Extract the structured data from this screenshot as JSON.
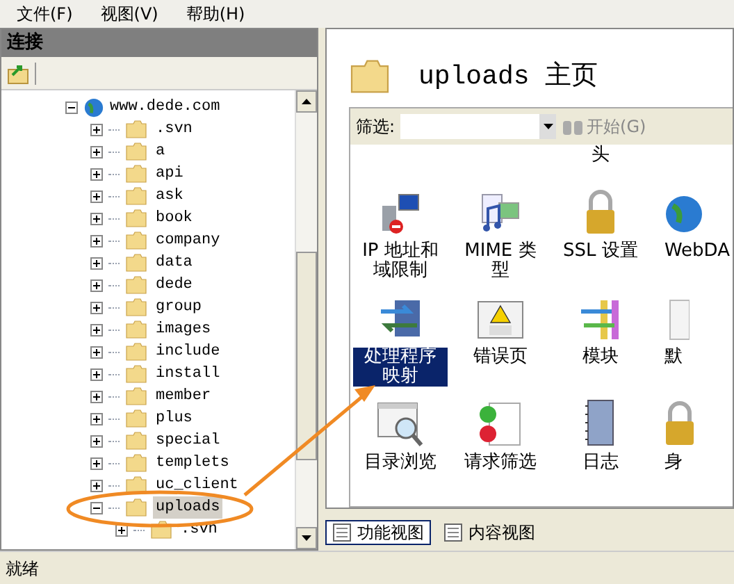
{
  "menu": [
    {
      "label": "文件(F)"
    },
    {
      "label": "视图(V)"
    },
    {
      "label": "帮助(H)"
    }
  ],
  "connections": {
    "title": "连接"
  },
  "tree": {
    "label": "www.dede.com",
    "expanded": true,
    "selected": false,
    "children": [
      {
        "label": ".svn",
        "expanded": false,
        "selected": false
      },
      {
        "label": "a",
        "expanded": false,
        "selected": false
      },
      {
        "label": "api",
        "expanded": false,
        "selected": false
      },
      {
        "label": "ask",
        "expanded": false,
        "selected": false
      },
      {
        "label": "book",
        "expanded": false,
        "selected": false
      },
      {
        "label": "company",
        "expanded": false,
        "selected": false
      },
      {
        "label": "data",
        "expanded": false,
        "selected": false
      },
      {
        "label": "dede",
        "expanded": false,
        "selected": false
      },
      {
        "label": "group",
        "expanded": false,
        "selected": false
      },
      {
        "label": "images",
        "expanded": false,
        "selected": false
      },
      {
        "label": "include",
        "expanded": false,
        "selected": false
      },
      {
        "label": "install",
        "expanded": false,
        "selected": false
      },
      {
        "label": "member",
        "expanded": false,
        "selected": false
      },
      {
        "label": "plus",
        "expanded": false,
        "selected": false
      },
      {
        "label": "special",
        "expanded": false,
        "selected": false
      },
      {
        "label": "templets",
        "expanded": false,
        "selected": false
      },
      {
        "label": "uc_client",
        "expanded": false,
        "selected": false
      },
      {
        "label": "uploads",
        "expanded": true,
        "selected": true,
        "children": [
          {
            "label": ".svn",
            "expanded": false,
            "selected": false
          }
        ]
      }
    ]
  },
  "content": {
    "title": "uploads 主页",
    "filter": {
      "label": "筛选:",
      "go": "开始(G)"
    },
    "cut_row_fragment": "头",
    "features": [
      {
        "kind": "ip",
        "label": "IP 地址和域限制",
        "selected": false
      },
      {
        "kind": "mime",
        "label": "MIME 类型",
        "selected": false
      },
      {
        "kind": "ssl",
        "label": "SSL 设置",
        "selected": false
      },
      {
        "kind": "globe",
        "label": "WebDA",
        "selected": false
      },
      {
        "kind": "handler",
        "label": "处理程序映射",
        "selected": true
      },
      {
        "kind": "error",
        "label": "错误页",
        "selected": false
      },
      {
        "kind": "module",
        "label": "模块",
        "selected": false
      },
      {
        "kind": "doc",
        "label": "默",
        "selected": false
      },
      {
        "kind": "browse",
        "label": "目录浏览",
        "selected": false
      },
      {
        "kind": "filter",
        "label": "请求筛选",
        "selected": false
      },
      {
        "kind": "log",
        "label": "日志",
        "selected": false
      },
      {
        "kind": "lock",
        "label": "身",
        "selected": false
      }
    ],
    "views": [
      {
        "label": "功能视图",
        "selected": true
      },
      {
        "label": "内容视图",
        "selected": false
      }
    ]
  },
  "status_bar": "就绪"
}
